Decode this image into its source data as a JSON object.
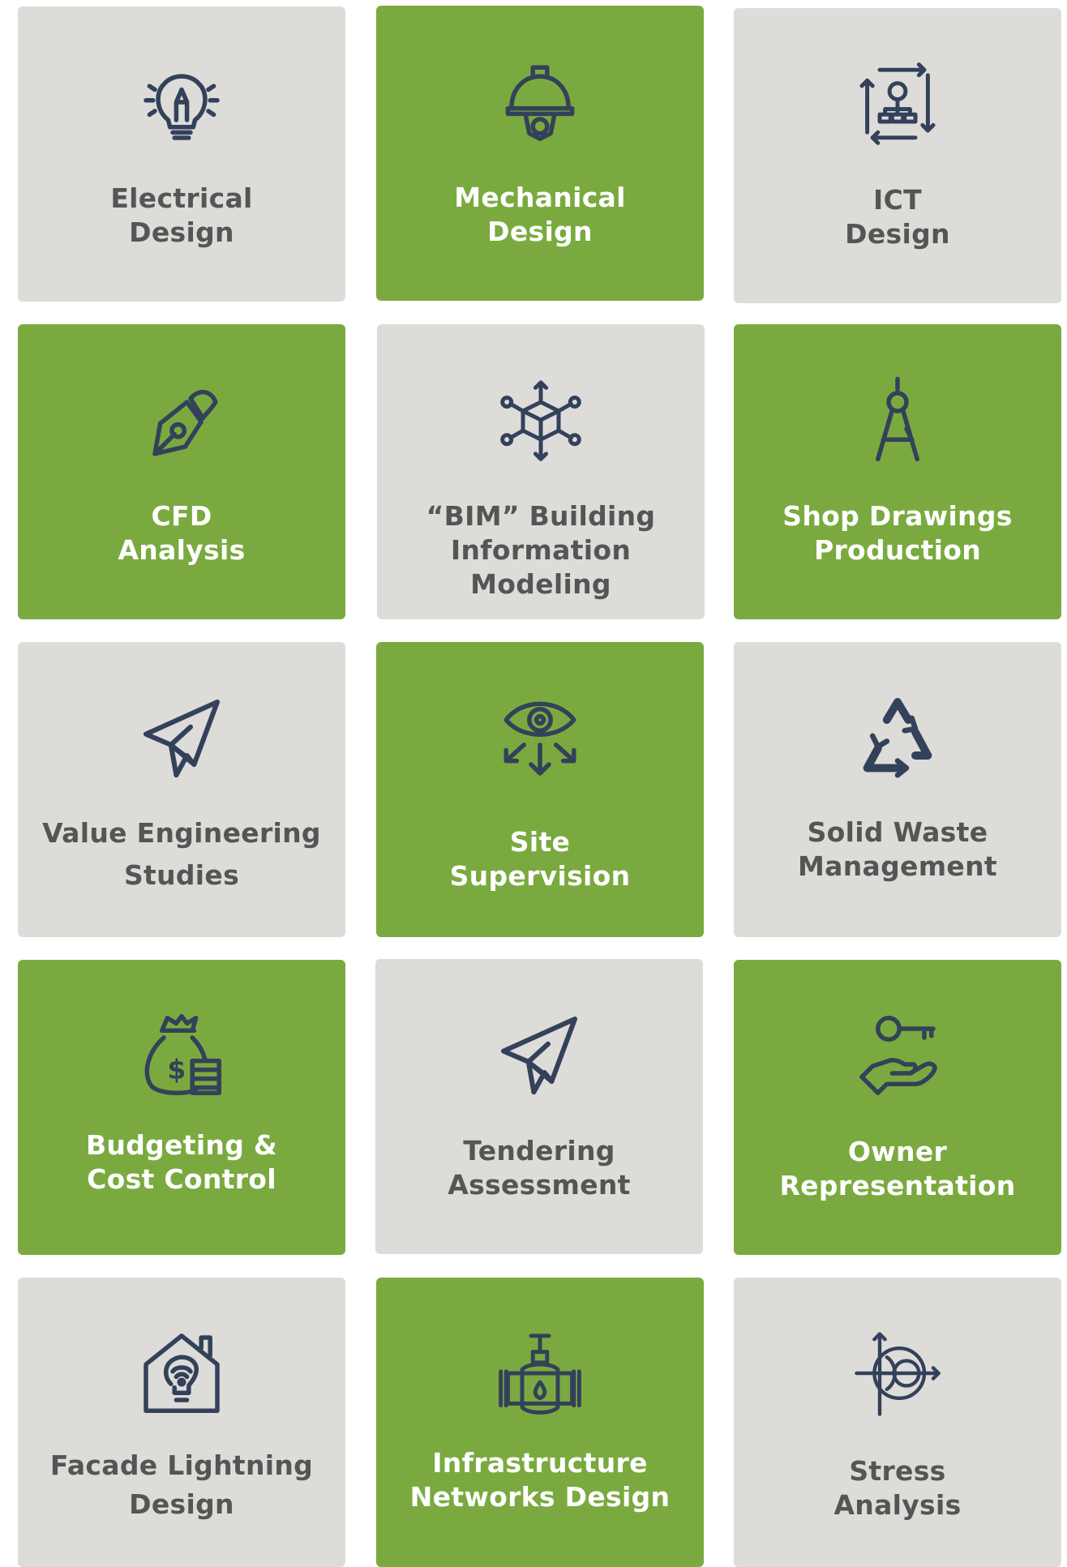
{
  "colors": {
    "green": "#7aaa3f",
    "gray": "#dddcd9",
    "icon": "#33415a",
    "gray_text": "#555555",
    "green_text": "#ffffff"
  },
  "tiles": [
    {
      "line1": "Electrical",
      "line2": "Design",
      "theme": "gray",
      "icon": "lightbulb-pencil-icon"
    },
    {
      "line1": "Mechanical",
      "line2": "Design",
      "theme": "green",
      "icon": "hardhat-gear-icon"
    },
    {
      "line1": "ICT",
      "line2": "Design",
      "theme": "gray",
      "icon": "network-gear-icon"
    },
    {
      "line1": "CFD",
      "line2": "Analysis",
      "theme": "green",
      "icon": "pen-nib-icon"
    },
    {
      "line1": "“BIM” Building",
      "line2": "Information Modeling",
      "theme": "gray",
      "icon": "cube-network-icon"
    },
    {
      "line1": "Shop Drawings",
      "line2": "Production",
      "theme": "green",
      "icon": "compass-icon"
    },
    {
      "line1": "Value Engineering",
      "line2": "Studies",
      "theme": "gray",
      "icon": "paper-plane-icon"
    },
    {
      "line1": "Site",
      "line2": "Supervision",
      "theme": "green",
      "icon": "eye-arrows-icon"
    },
    {
      "line1": "Solid Waste",
      "line2": "Management",
      "theme": "gray",
      "icon": "recycle-icon"
    },
    {
      "line1": "Budgeting &",
      "line2": "Cost Control",
      "theme": "green",
      "icon": "money-bag-icon"
    },
    {
      "line1": "Tendering",
      "line2": "Assessment",
      "theme": "gray",
      "icon": "paper-plane-icon"
    },
    {
      "line1": "Owner",
      "line2": "Representation",
      "theme": "green",
      "icon": "hand-key-icon"
    },
    {
      "line1": "Facade Lightning",
      "line2": "Design",
      "theme": "gray",
      "icon": "house-bulb-icon"
    },
    {
      "line1": "Infrastructure",
      "line2": "Networks Design",
      "theme": "green",
      "icon": "pipe-valve-icon"
    },
    {
      "line1": "Stress",
      "line2": "Analysis",
      "theme": "gray",
      "icon": "stress-chart-icon"
    }
  ]
}
